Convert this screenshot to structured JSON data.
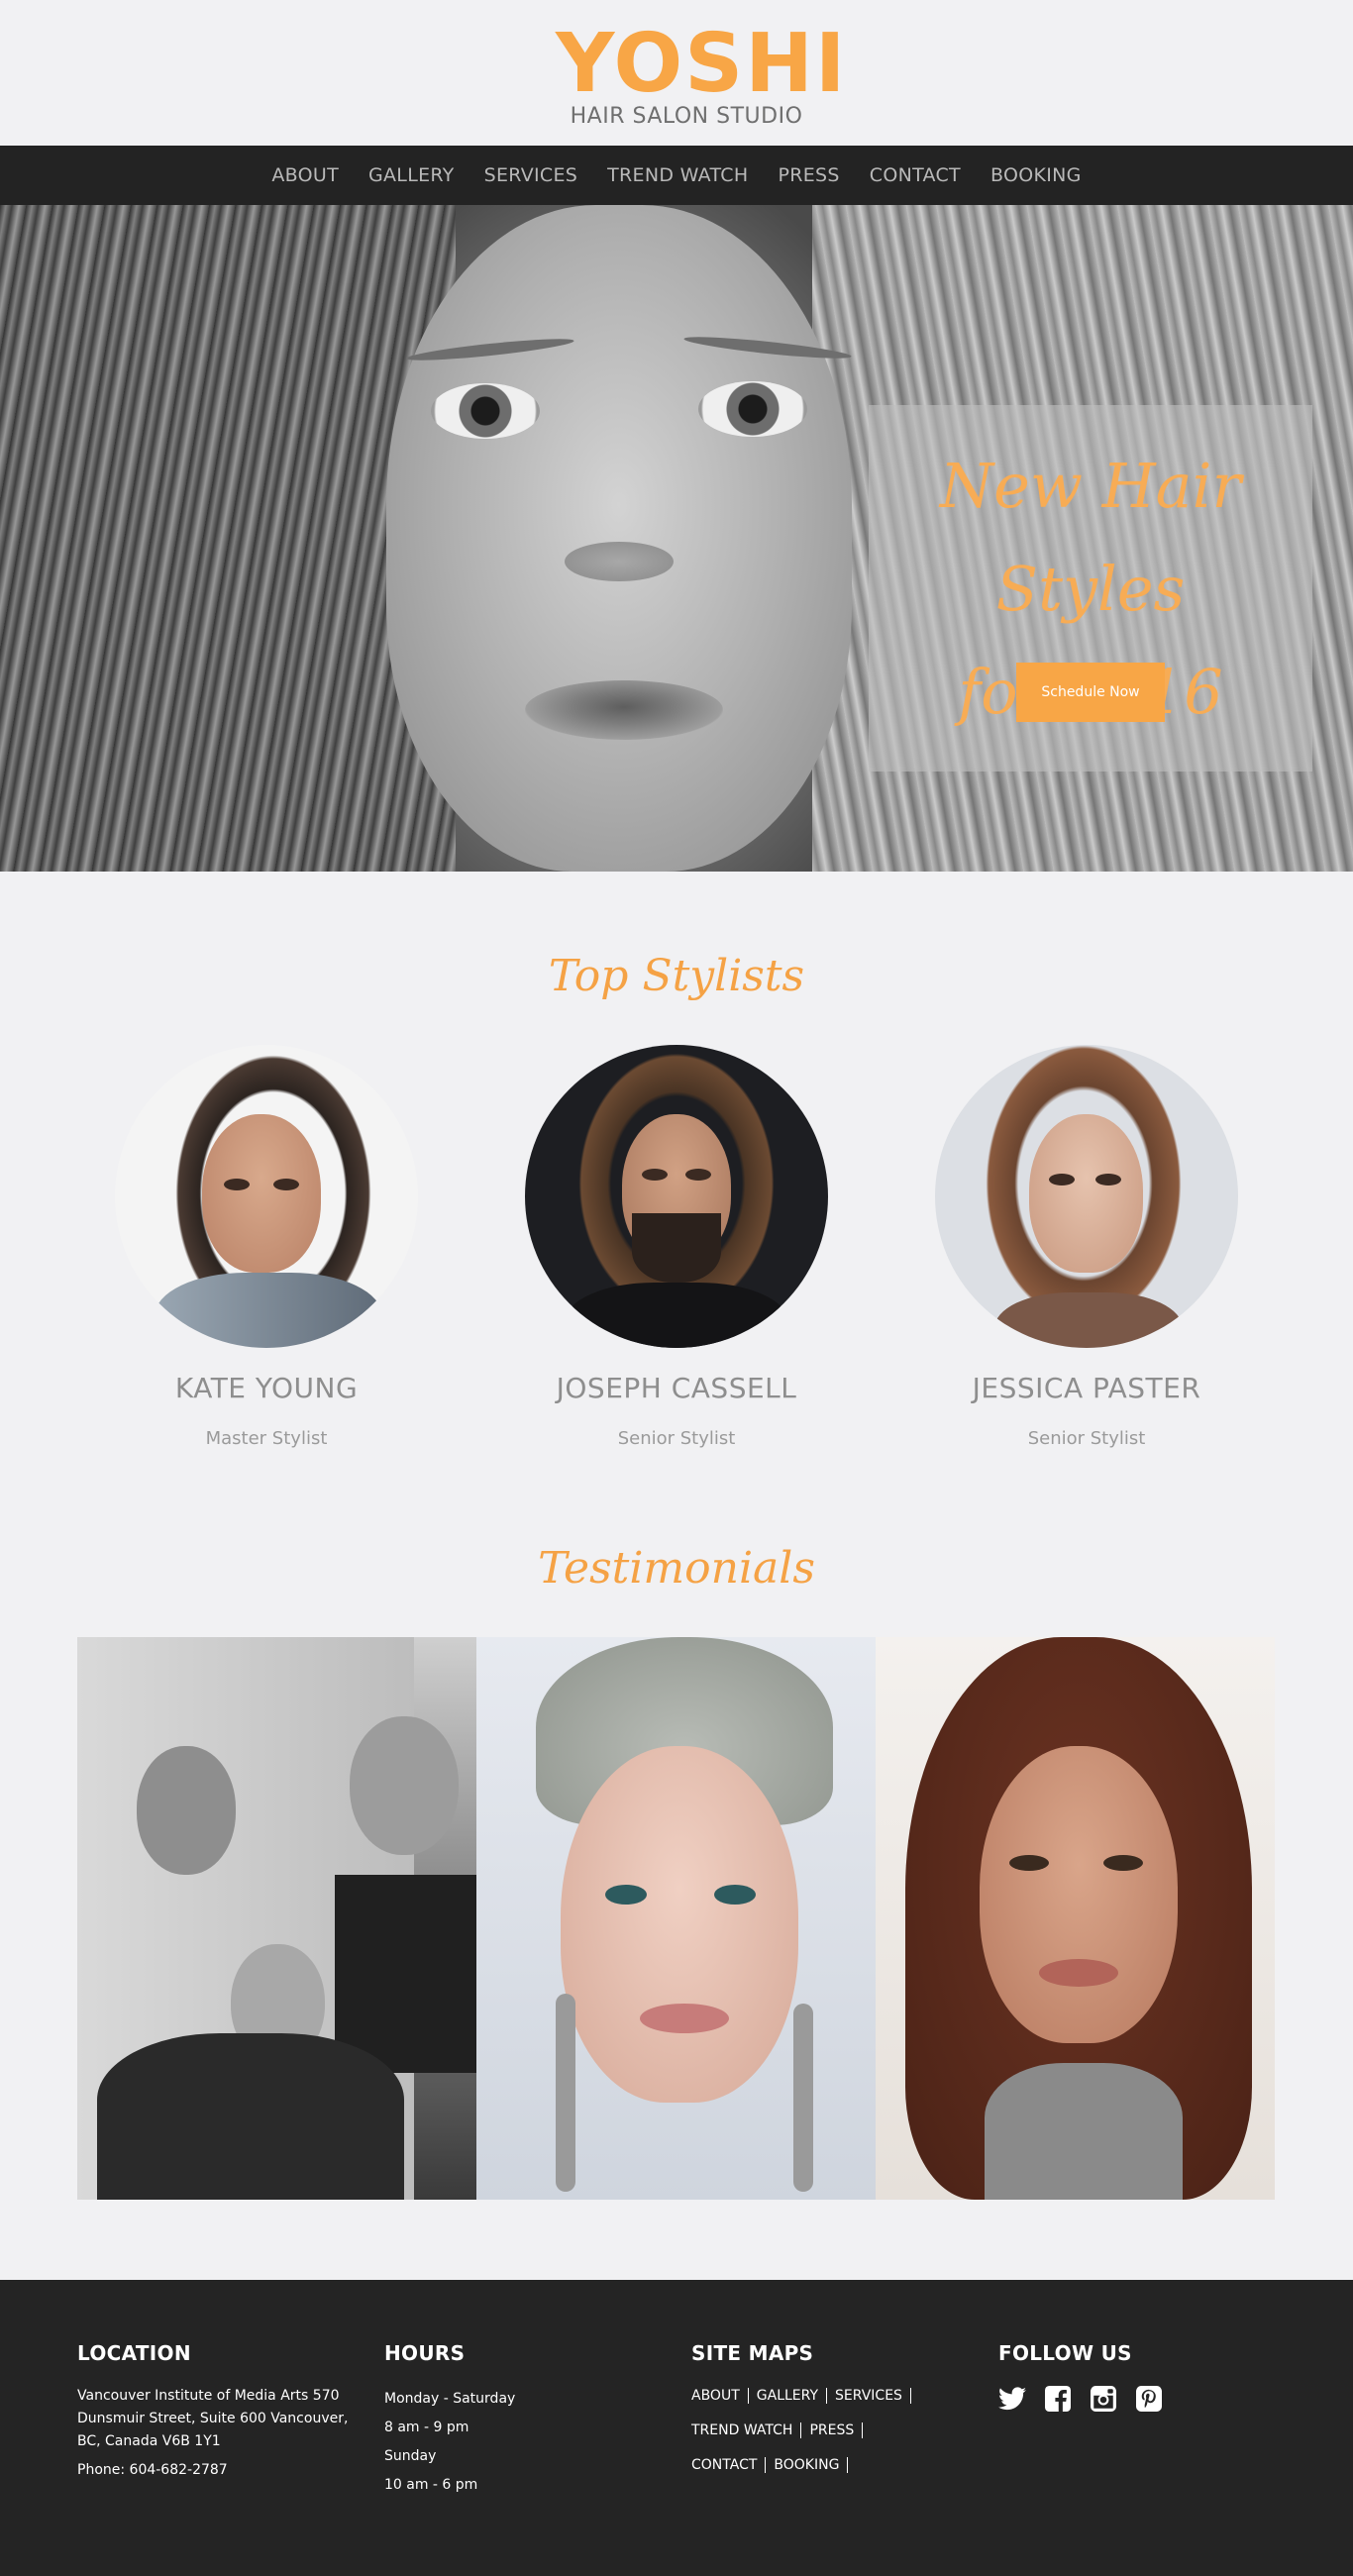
{
  "brand": {
    "logo_word": "YOSHI",
    "logo_sub": "HAIR SALON STUDIO",
    "accent_color": "#f8a646"
  },
  "nav": {
    "items": [
      "ABOUT",
      "GALLERY",
      "SERVICES",
      "TREND WATCH",
      "PRESS",
      "CONTACT",
      "BOOKING"
    ]
  },
  "hero": {
    "title_line1": "New Hair Styles",
    "title_line2": "for 2016",
    "cta_label": "Schedule Now"
  },
  "stylists": {
    "title": "Top Stylists",
    "items": [
      {
        "name": "KATE YOUNG",
        "role": "Master Stylist"
      },
      {
        "name": "JOSEPH CASSELL",
        "role": "Senior Stylist"
      },
      {
        "name": "JESSICA PASTER",
        "role": "Senior Stylist"
      }
    ]
  },
  "testimonials": {
    "title": "Testimonials"
  },
  "footer": {
    "location": {
      "heading": "LOCATION",
      "address_line1": "Vancouver Institute of Media Arts 570",
      "address_line2": "Dunsmuir Street, Suite 600 Vancouver,",
      "address_line3": "BC, Canada V6B 1Y1",
      "phone": "Phone: 604-682-2787"
    },
    "hours": {
      "heading": "HOURS",
      "line1": "Monday - Saturday",
      "line2": "8 am - 9 pm",
      "line3": "Sunday",
      "line4": "10 am - 6 pm"
    },
    "sitemap": {
      "heading": "SITE MAPS",
      "links": [
        "ABOUT",
        "GALLERY",
        "SERVICES",
        "TREND WATCH",
        "PRESS",
        "CONTACT",
        "BOOKING"
      ]
    },
    "follow": {
      "heading": "FOLLOW US",
      "icons": [
        "twitter-icon",
        "facebook-icon",
        "instagram-icon",
        "pinterest-icon"
      ]
    }
  }
}
